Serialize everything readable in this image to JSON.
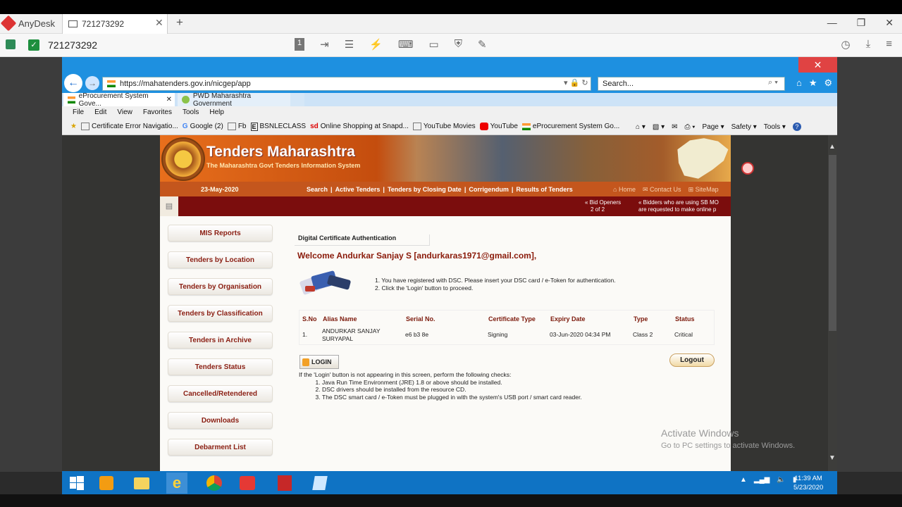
{
  "anydesk": {
    "app_name": "AnyDesk",
    "tab_label": "721273292",
    "address": "721273292"
  },
  "ie": {
    "url": "https://mahatenders.gov.in/nicgep/app",
    "search_placeholder": "Search...",
    "tabs": [
      {
        "label": "eProcurement System Gove..."
      },
      {
        "label": "PWD Maharashtra Government"
      }
    ],
    "menu": [
      "File",
      "Edit",
      "View",
      "Favorites",
      "Tools",
      "Help"
    ],
    "favorites": [
      "Certificate Error Navigatio...",
      "Google (2)",
      "Fb",
      "BSNLECLASS",
      "Online Shopping at Snapd...",
      "YouTube Movies",
      "YouTube",
      "eProcurement System Go..."
    ],
    "commands": [
      "Page ▾",
      "Safety ▾",
      "Tools ▾"
    ]
  },
  "site": {
    "title": "Tenders Maharashtra",
    "tagline": "The Maharashtra Govt Tenders Information System",
    "date": "23-May-2020",
    "nav": [
      "Search",
      "Active Tenders",
      "Tenders by Closing Date",
      "Corrigendum",
      "Results of Tenders"
    ],
    "nav_right": [
      "Home",
      "Contact Us",
      "SiteMap"
    ],
    "ticker1_l1": "« Bid Openers",
    "ticker1_l2": "2 of 2",
    "ticker2_l1": "« Bidders who are using SB MO",
    "ticker2_l2": "are requested to make online p",
    "sidebar": [
      "MIS Reports",
      "Tenders by Location",
      "Tenders by Organisation",
      "Tenders by Classification",
      "Tenders in Archive",
      "Tenders Status",
      "Cancelled/Retendered",
      "Downloads",
      "Debarment List"
    ],
    "section_title": "Digital Certificate Authentication",
    "welcome": "Welcome Andurkar Sanjay S [andurkaras1971@gmail.com],",
    "instructions": [
      "1.  You have registered with DSC. Please insert your DSC card / e-Token for authentication.",
      "2.  Click the 'Login' button to proceed."
    ],
    "table": {
      "headers": [
        "S.No",
        "Alias Name",
        "Serial No.",
        "Certificate Type",
        "Expiry Date",
        "Type",
        "Status"
      ],
      "row": {
        "sno": "1.",
        "alias_l1": "ANDURKAR SANJAY",
        "alias_l2": "SURYAPAL",
        "serial": "e6 b3 8e",
        "cert_type": "Signing",
        "expiry": "03-Jun-2020 04:34 PM",
        "type": "Class 2",
        "status": "Critical"
      }
    },
    "login_label": "LOGIN",
    "logout_label": "Logout",
    "checks_intro": "If the 'Login' button is not appearing in this screen, perform the following checks:",
    "checks": [
      "Java Run Time Environment (JRE) 1.8 or above should be installed.",
      "DSC drivers should be installed from the resource CD.",
      "The DSC smart card / e-Token must be plugged in with the system's USB port / smart card reader."
    ]
  },
  "watermark": {
    "line1": "Activate Windows",
    "line2": "Go to PC settings to activate Windows."
  },
  "clock": {
    "time": "11:39 AM",
    "date": "5/23/2020"
  },
  "colors": {
    "ie_blue": "#1e90e0",
    "banner_orange": "#c4561d",
    "ticker_red": "#7b0d0d",
    "sidebar_text": "#8a1e12",
    "taskbar": "#0f73c4"
  }
}
